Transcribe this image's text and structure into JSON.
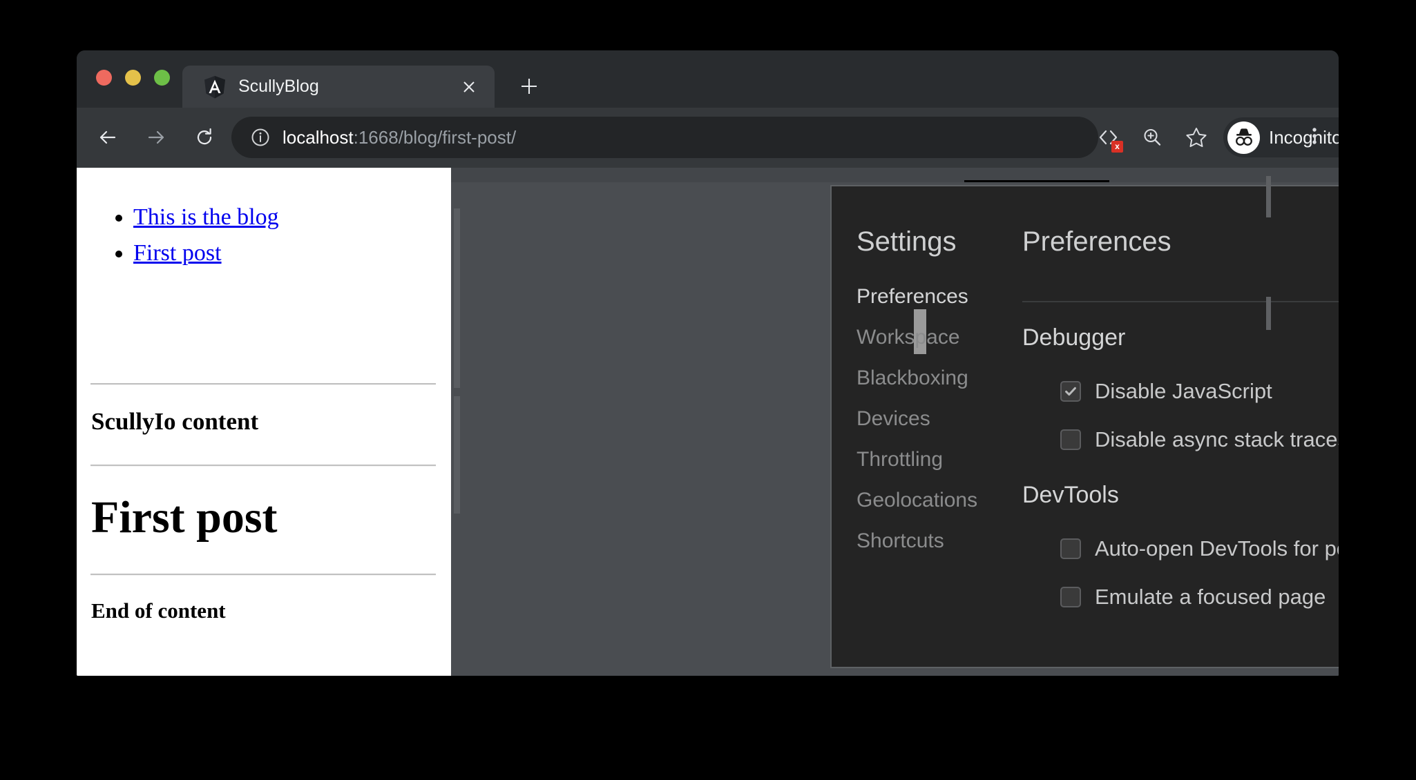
{
  "browser": {
    "tab": {
      "title": "ScullyBlog",
      "favicon": "angular-shield-icon",
      "close_icon": "close-icon"
    },
    "new_tab_icon": "plus-icon",
    "traffic_lights": {
      "close": "#ee6a5f",
      "minimize": "#e4c14a",
      "maximize": "#6dbf47"
    },
    "nav": {
      "back_icon": "arrow-left-icon",
      "forward_icon": "arrow-right-icon",
      "reload_icon": "reload-icon"
    },
    "omnibox": {
      "info_icon": "info-circle-icon",
      "url_host": "localhost",
      "url_path": ":1668/blog/first-post/"
    },
    "toolbar_icons": {
      "devtools": "devtools-error-icon",
      "devtools_badge": "x",
      "zoom": "zoom-in-icon",
      "bookmark": "star-icon",
      "menu": "three-dot-menu-icon"
    },
    "profile": {
      "label": "Incognito",
      "icon": "incognito-hat-glasses-icon"
    }
  },
  "page": {
    "links": [
      {
        "label": "This is the blog"
      },
      {
        "label": "First post"
      }
    ],
    "heading_content": "ScullyIo content",
    "heading_post": "First post",
    "heading_end": "End of content"
  },
  "devtools": {
    "settings": {
      "title": "Settings",
      "close_icon": "close-icon",
      "nav": [
        {
          "label": "Preferences",
          "selected": true
        },
        {
          "label": "Workspace",
          "selected": false
        },
        {
          "label": "Blackboxing",
          "selected": false
        },
        {
          "label": "Devices",
          "selected": false
        },
        {
          "label": "Throttling",
          "selected": false
        },
        {
          "label": "Geolocations",
          "selected": false
        },
        {
          "label": "Shortcuts",
          "selected": false
        }
      ],
      "content": {
        "title": "Preferences",
        "sections": [
          {
            "heading": "Debugger",
            "options": [
              {
                "label": "Disable JavaScript",
                "checked": true
              },
              {
                "label": "Disable async stack traces",
                "checked": false
              }
            ]
          },
          {
            "heading": "DevTools",
            "options": [
              {
                "label": "Auto-open DevTools for popups",
                "checked": false
              },
              {
                "label": "Emulate a focused page",
                "checked": false
              }
            ]
          }
        ]
      }
    }
  }
}
